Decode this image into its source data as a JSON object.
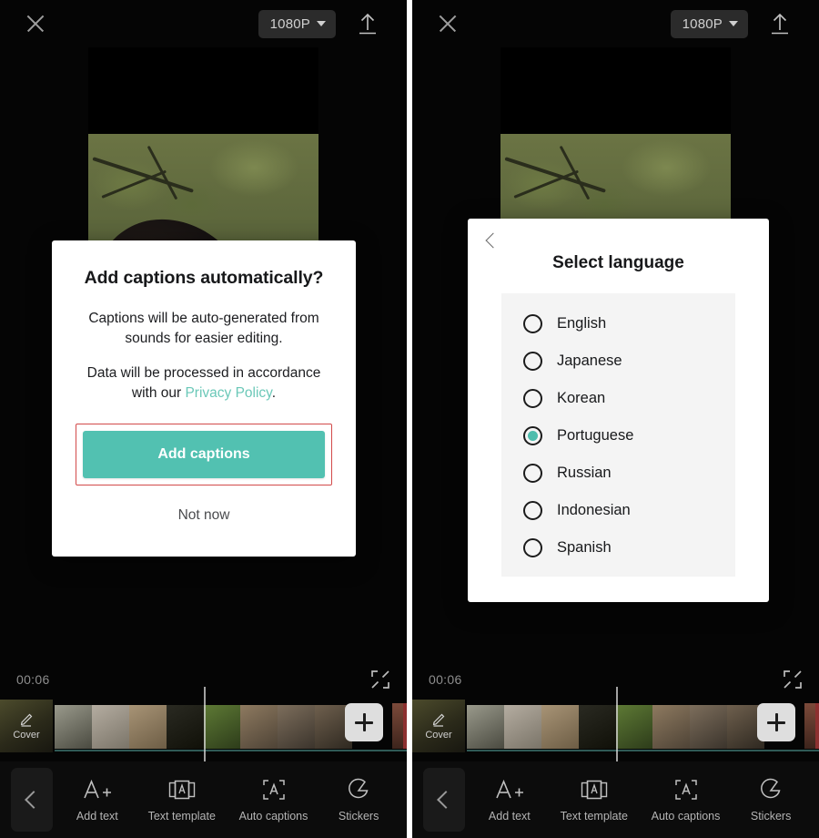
{
  "app": {
    "background_color": "#050505",
    "accent_color": "#52c1b1",
    "highlight_color": "#d24a4a"
  },
  "topbar": {
    "close_icon": "close-icon",
    "resolution_label": "1080P",
    "resolution_caret_icon": "chevron-down-icon",
    "export_icon": "upload-arrow-icon"
  },
  "player": {
    "timestamp": "00:06",
    "expand_icon": "fullscreen-expand-icon"
  },
  "timeline": {
    "cover_label": "Cover",
    "cover_icon": "pencil-edit-icon",
    "add_clip_icon": "plus-icon"
  },
  "bottom_toolbar": {
    "back_icon": "chevron-left-icon",
    "tools": [
      {
        "label": "Add text",
        "icon": "a-plus-icon"
      },
      {
        "label": "Text template",
        "icon": "text-template-icon"
      },
      {
        "label": "Auto captions",
        "icon": "auto-captions-icon"
      },
      {
        "label": "Stickers",
        "icon": "sticker-icon"
      }
    ]
  },
  "dialog": {
    "title": "Add captions automatically?",
    "body_line1": "Captions will be auto-generated from sounds for easier editing.",
    "body_line2_prefix": "Data will be processed in accordance with our ",
    "body_link": "Privacy Policy",
    "body_line2_suffix": ".",
    "primary_button": "Add captions",
    "secondary_button": "Not now"
  },
  "language_sheet": {
    "back_icon": "chevron-left-icon",
    "title": "Select language",
    "selected": "Portuguese",
    "options": [
      {
        "label": "English",
        "selected": false
      },
      {
        "label": "Japanese",
        "selected": false
      },
      {
        "label": "Korean",
        "selected": false
      },
      {
        "label": "Portuguese",
        "selected": true
      },
      {
        "label": "Russian",
        "selected": false
      },
      {
        "label": "Indonesian",
        "selected": false
      },
      {
        "label": "Spanish",
        "selected": false
      }
    ]
  }
}
